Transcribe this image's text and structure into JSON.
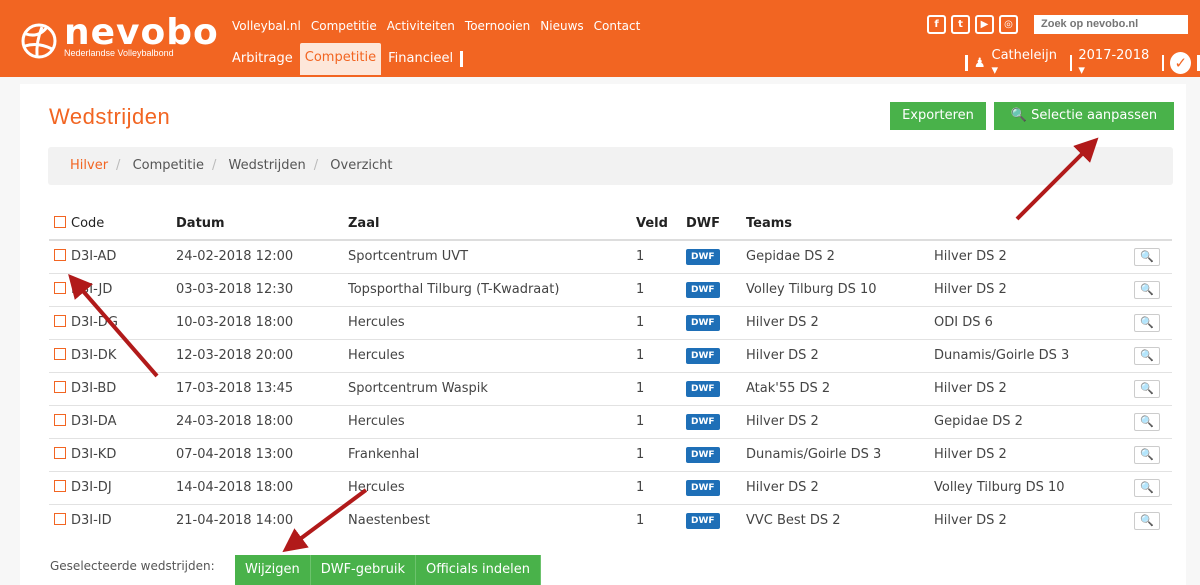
{
  "header": {
    "logo_text": "nevobo",
    "logo_sub": "Nederlandse Volleybalbond",
    "topnav": [
      "Volleybal.nl",
      "Competitie",
      "Activiteiten",
      "Toernooien",
      "Nieuws",
      "Contact"
    ],
    "subnav": [
      "Arbitrage",
      "Competitie",
      "Financieel"
    ],
    "subnav_active": "Competitie",
    "social": [
      "f",
      "t",
      "yt",
      "ig"
    ],
    "search_placeholder": "Zoek op nevobo.nl",
    "user": "Catheleijn",
    "season": "2017-2018"
  },
  "page": {
    "title": "Wedstrijden",
    "export_label": "Exporteren",
    "selection_label": "Selectie aanpassen",
    "breadcrumb": [
      "Hilver",
      "Competitie",
      "Wedstrijden",
      "Overzicht"
    ]
  },
  "table": {
    "headers": {
      "code": "Code",
      "datum": "Datum",
      "zaal": "Zaal",
      "veld": "Veld",
      "dwf": "DWF",
      "teams": "Teams"
    },
    "dwf_badge": "DWF",
    "rows": [
      {
        "code": "D3I-AD",
        "datum": "24-02-2018 12:00",
        "zaal": "Sportcentrum UVT",
        "veld": "1",
        "team1": "Gepidae DS 2",
        "team2": "Hilver DS 2"
      },
      {
        "code": "D3I-JD",
        "datum": "03-03-2018 12:30",
        "zaal": "Topsporthal Tilburg (T-Kwadraat)",
        "veld": "1",
        "team1": "Volley Tilburg DS 10",
        "team2": "Hilver DS 2"
      },
      {
        "code": "D3I-DG",
        "datum": "10-03-2018 18:00",
        "zaal": "Hercules",
        "veld": "1",
        "team1": "Hilver DS 2",
        "team2": "ODI DS 6"
      },
      {
        "code": "D3I-DK",
        "datum": "12-03-2018 20:00",
        "zaal": "Hercules",
        "veld": "1",
        "team1": "Hilver DS 2",
        "team2": "Dunamis/Goirle DS 3"
      },
      {
        "code": "D3I-BD",
        "datum": "17-03-2018 13:45",
        "zaal": "Sportcentrum Waspik",
        "veld": "1",
        "team1": "Atak'55 DS 2",
        "team2": "Hilver DS 2"
      },
      {
        "code": "D3I-DA",
        "datum": "24-03-2018 18:00",
        "zaal": "Hercules",
        "veld": "1",
        "team1": "Hilver DS 2",
        "team2": "Gepidae DS 2"
      },
      {
        "code": "D3I-KD",
        "datum": "07-04-2018 13:00",
        "zaal": "Frankenhal",
        "veld": "1",
        "team1": "Dunamis/Goirle DS 3",
        "team2": "Hilver DS 2"
      },
      {
        "code": "D3I-DJ",
        "datum": "14-04-2018 18:00",
        "zaal": "Hercules",
        "veld": "1",
        "team1": "Hilver DS 2",
        "team2": "Volley Tilburg DS 10"
      },
      {
        "code": "D3I-ID",
        "datum": "21-04-2018 14:00",
        "zaal": "Naestenbest",
        "veld": "1",
        "team1": "VVC Best DS 2",
        "team2": "Hilver DS 2"
      }
    ]
  },
  "footer": {
    "label": "Geselecteerde wedstrijden:",
    "actions": [
      "Wijzigen",
      "DWF-gebruik",
      "Officials indelen"
    ]
  },
  "colors": {
    "brand": "#f26522",
    "green": "#49b24a",
    "dwf_blue": "#1e6fb7",
    "arrow": "#b11a1a"
  }
}
